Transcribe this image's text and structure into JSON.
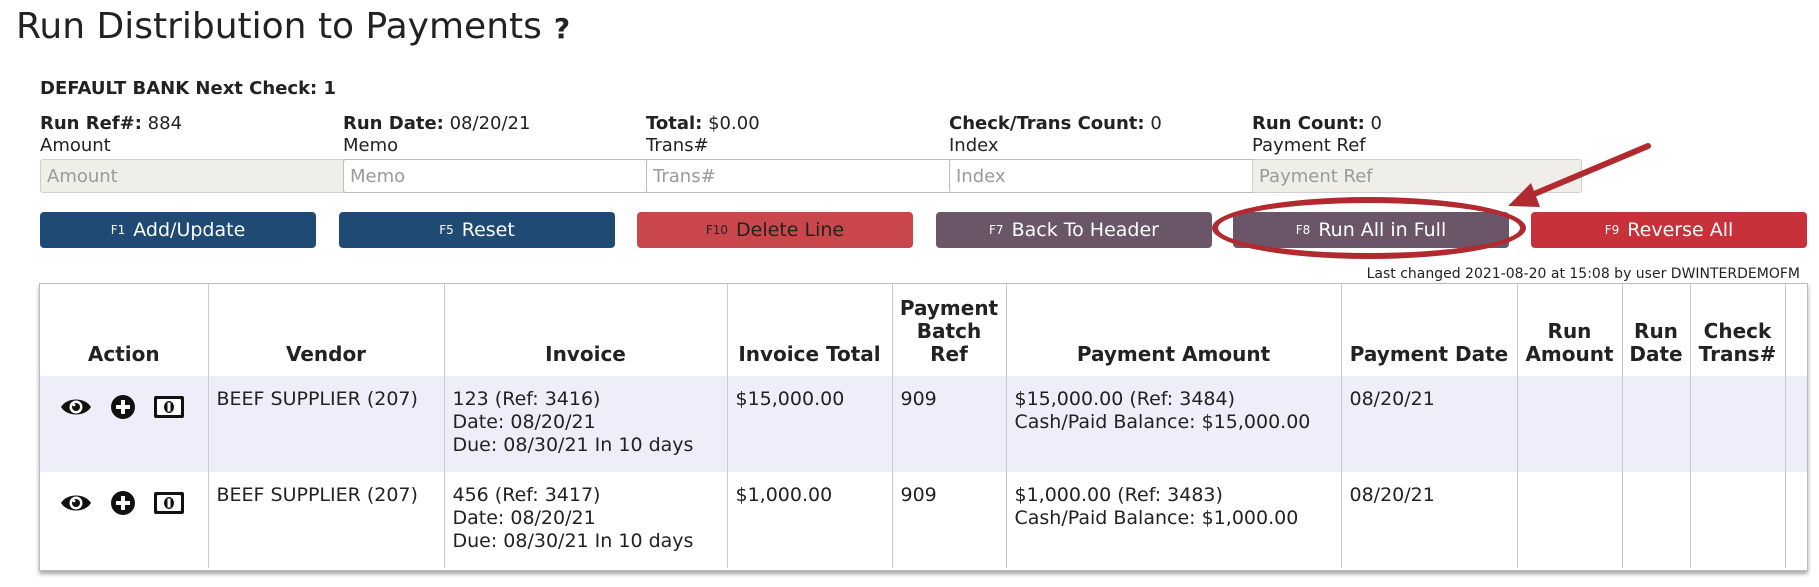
{
  "title": "Run Distribution to Payments",
  "help_label": "?",
  "bank_line": "DEFAULT BANK Next Check: 1",
  "fields": [
    {
      "header_label": "Run Ref#:",
      "header_value": "884",
      "label": "Amount",
      "placeholder": "Amount",
      "disabled": true
    },
    {
      "header_label": "Run Date:",
      "header_value": "08/20/21",
      "label": "Memo",
      "placeholder": "Memo",
      "disabled": false
    },
    {
      "header_label": "Total:",
      "header_value": "$0.00",
      "label": "Trans#",
      "placeholder": "Trans#",
      "disabled": false
    },
    {
      "header_label": "Check/Trans Count:",
      "header_value": "0",
      "label": "Index",
      "placeholder": "Index",
      "disabled": false
    },
    {
      "header_label": "Run Count:",
      "header_value": "0",
      "label": "Payment Ref",
      "placeholder": "Payment Ref",
      "disabled": true
    }
  ],
  "buttons": [
    {
      "key": "F1",
      "label": "Add/Update"
    },
    {
      "key": "F5",
      "label": "Reset"
    },
    {
      "key": "F10",
      "label": "Delete Line"
    },
    {
      "key": "F7",
      "label": "Back To Header"
    },
    {
      "key": "F8",
      "label": "Run All in Full"
    },
    {
      "key": "F9",
      "label": "Reverse All"
    }
  ],
  "colors": {
    "blue": "#1f4a73",
    "red_light": "#c9474a",
    "purple": "#6a5668",
    "red_dark": "#c8303a",
    "annotation": "#b02a30",
    "row_highlight": "#eeeefa"
  },
  "last_changed": "Last changed 2021-08-20 at 15:08 by user DWINTERDEMOFM",
  "table": {
    "headers": {
      "action": "Action",
      "vendor": "Vendor",
      "invoice": "Invoice",
      "invoice_total": "Invoice Total",
      "payment_batch_ref": "Payment Batch Ref",
      "payment_amount": "Payment Amount",
      "payment_date": "Payment Date",
      "run_amount": "Run Amount",
      "run_date": "Run Date",
      "check_trans": "Check Trans#"
    },
    "action_icons": [
      "eye-icon",
      "plus-circle-icon",
      "money-icon"
    ],
    "rows": [
      {
        "vendor": "BEEF SUPPLIER (207)",
        "invoice_line1": "123 (Ref: 3416)",
        "invoice_line2": "Date: 08/20/21",
        "invoice_line3": "Due: 08/30/21 In 10 days",
        "invoice_total": "$15,000.00",
        "payment_batch_ref": "909",
        "payment_amount_line1": "$15,000.00 (Ref: 3484)",
        "payment_amount_line2": "Cash/Paid Balance: $15,000.00",
        "payment_date": "08/20/21",
        "run_amount": "",
        "run_date": "",
        "check_trans": ""
      },
      {
        "vendor": "BEEF SUPPLIER (207)",
        "invoice_line1": "456 (Ref: 3417)",
        "invoice_line2": "Date: 08/20/21",
        "invoice_line3": "Due: 08/30/21 In 10 days",
        "invoice_total": "$1,000.00",
        "payment_batch_ref": "909",
        "payment_amount_line1": "$1,000.00 (Ref: 3483)",
        "payment_amount_line2": "Cash/Paid Balance: $1,000.00",
        "payment_date": "08/20/21",
        "run_amount": "",
        "run_date": "",
        "check_trans": ""
      }
    ]
  }
}
